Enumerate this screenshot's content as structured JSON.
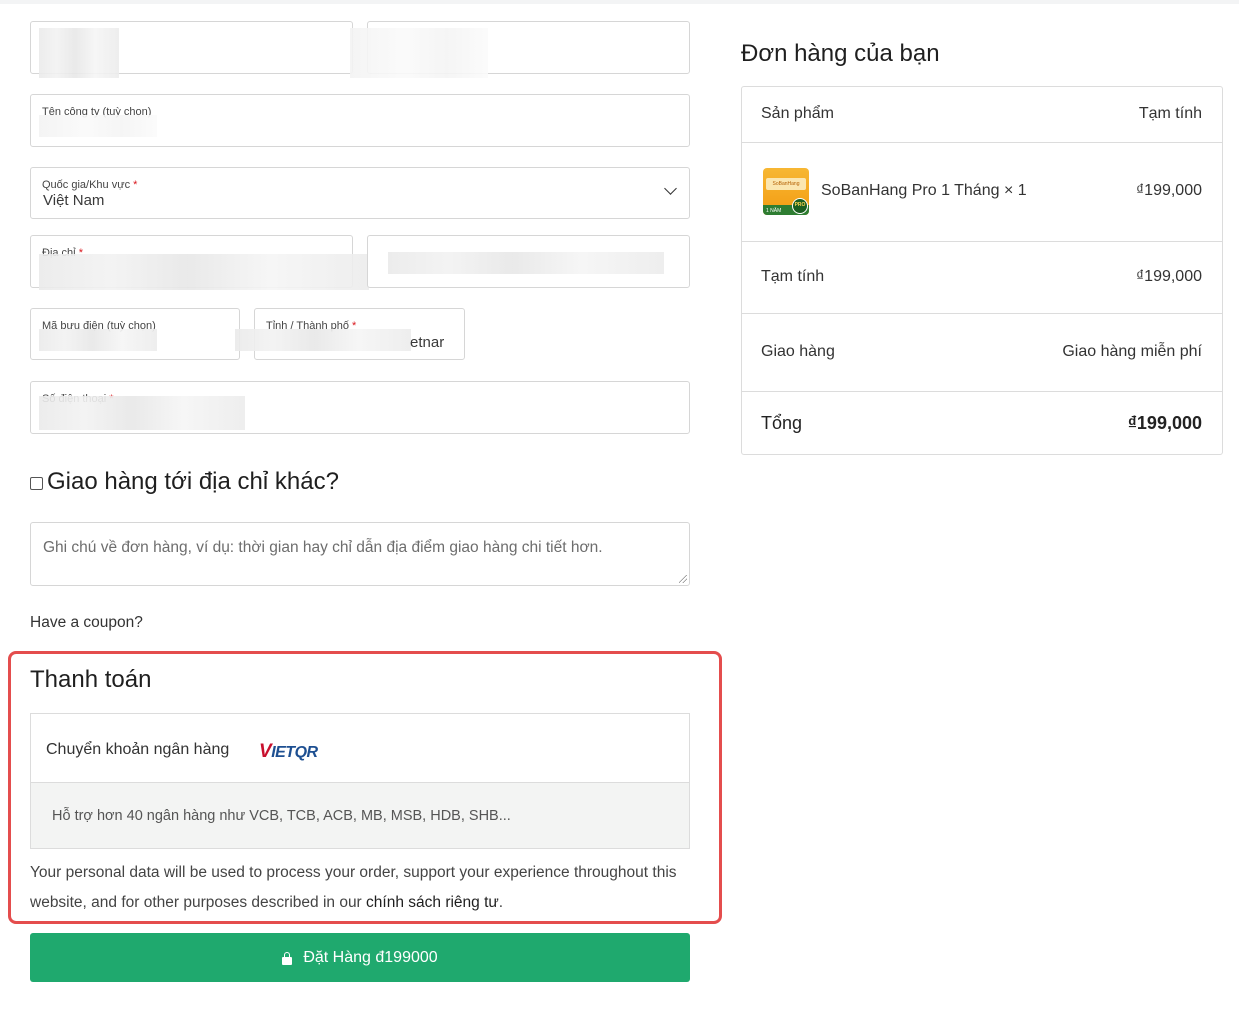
{
  "billing": {
    "company_label": "Tên công ty (tuỳ chọn)",
    "country_label": "Quốc gia/Khu vực",
    "country_value": "Việt Nam",
    "address_label": "Địa chỉ",
    "postcode_label": "Mã bưu điện (tuỳ chọn)",
    "city_label": "Tỉnh / Thành phố",
    "city_value_partial": "etnar",
    "phone_label": "Số điện thoại",
    "required_mark": "*"
  },
  "ship_to_different": {
    "label": "Giao hàng tới địa chỉ khác?"
  },
  "order_notes": {
    "placeholder": "Ghi chú về đơn hàng, ví dụ: thời gian hay chỉ dẫn địa điểm giao hàng chi tiết hơn."
  },
  "coupon": {
    "text": "Have a coupon?"
  },
  "payment": {
    "title": "Thanh toán",
    "method_label": "Chuyển khoản ngân hàng",
    "method_logo_v": "V",
    "method_logo_iet": "IET",
    "method_logo_qr": "QR",
    "description": "Hỗ trợ hơn 40 ngân hàng như VCB, TCB, ACB, MB, MSB, HDB, SHB...",
    "privacy_text": "Your personal data will be used to process your order, support your experience throughout this website, and for other purposes described in our",
    "privacy_link": "chính sách riêng tư",
    "privacy_end": "."
  },
  "place_order": {
    "label": "Đặt Hàng đ199000"
  },
  "order": {
    "title": "Đơn hàng của bạn",
    "header_product": "Sản phẩm",
    "header_subtotal": "Tạm tính",
    "product_name": "SoBanHang Pro 1 Tháng",
    "product_qty": "× 1",
    "product_thumb_brand": "SoBanHang",
    "product_thumb_years": "1 NĂM",
    "product_thumb_badge": "PRO",
    "product_price": "₫199,000",
    "subtotal_label": "Tạm tính",
    "subtotal_value": "₫199,000",
    "shipping_label": "Giao hàng",
    "shipping_value": "Giao hàng miễn phí",
    "total_label": "Tổng",
    "total_value": "₫199,000"
  },
  "colors": {
    "accent_green": "#1fa96e",
    "highlight_red": "#e44d4d",
    "required_red": "#d9161c"
  }
}
